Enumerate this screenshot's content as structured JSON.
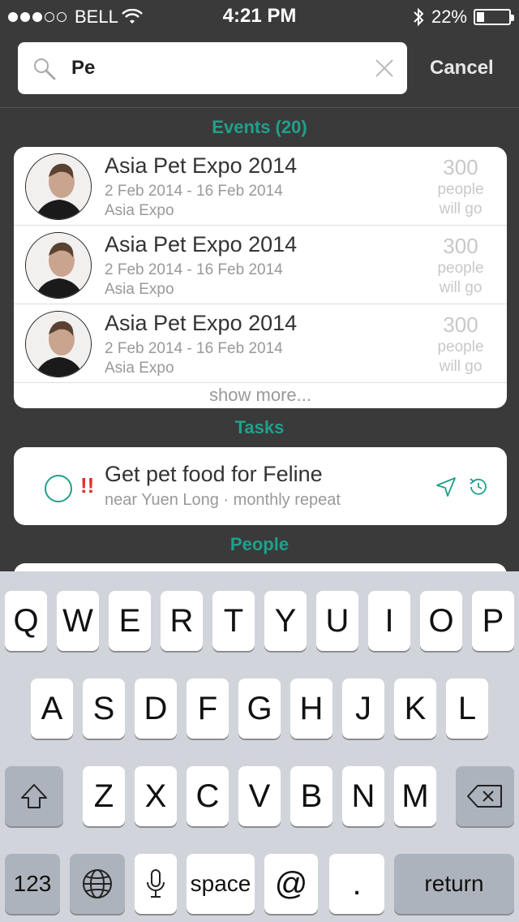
{
  "status_bar": {
    "carrier": "BELL",
    "time": "4:21 PM",
    "battery_percent_label": "22%",
    "battery_level": 0.22
  },
  "search": {
    "query": "Pe",
    "cancel_label": "Cancel"
  },
  "events": {
    "header": "Events (20)",
    "items": [
      {
        "title": "Asia Pet Expo 2014",
        "dates": "2 Feb 2014 - 16 Feb 2014",
        "venue": "Asia Expo",
        "count": "300",
        "count_unit_1": "people",
        "count_unit_2": "will go"
      },
      {
        "title": "Asia Pet Expo 2014",
        "dates": "2 Feb 2014 - 16 Feb 2014",
        "venue": "Asia Expo",
        "count": "300",
        "count_unit_1": "people",
        "count_unit_2": "will go"
      },
      {
        "title": "Asia Pet Expo 2014",
        "dates": "2 Feb 2014 - 16 Feb 2014",
        "venue": "Asia Expo",
        "count": "300",
        "count_unit_1": "people",
        "count_unit_2": "will go"
      }
    ],
    "show_more": "show more..."
  },
  "tasks": {
    "header": "Tasks",
    "items": [
      {
        "priority": "!!",
        "title": "Get pet food for Feline",
        "subtitle": "near Yuen Long · monthly repeat"
      }
    ]
  },
  "people": {
    "header": "People"
  },
  "keyboard": {
    "row1": [
      "Q",
      "W",
      "E",
      "R",
      "T",
      "Y",
      "U",
      "I",
      "O",
      "P"
    ],
    "row2": [
      "A",
      "S",
      "D",
      "F",
      "G",
      "H",
      "J",
      "K",
      "L"
    ],
    "row3": [
      "Z",
      "X",
      "C",
      "V",
      "B",
      "N",
      "M"
    ],
    "numbers_label": "123",
    "space_label": "space",
    "at_label": "@",
    "period_label": ".",
    "return_label": "return"
  },
  "colors": {
    "accent": "#20a08c",
    "background": "#3a3a3a",
    "priority": "#e03030"
  }
}
